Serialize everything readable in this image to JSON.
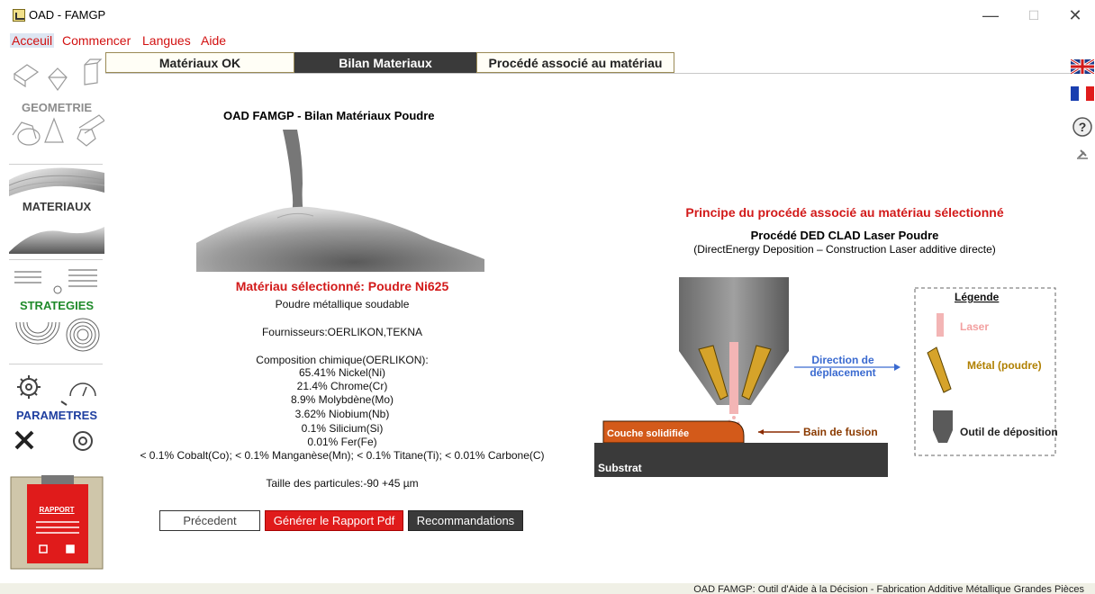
{
  "window": {
    "title": "OAD - FAMGP",
    "minimize": "—",
    "maximize": "☐",
    "close": "✕"
  },
  "menu": [
    "Acceuil",
    "Commencer",
    "Langues",
    "Aide"
  ],
  "sidebar": {
    "geometrie": "GEOMETRIE",
    "materiaux": "MATERIAUX",
    "strategies": "STRATEGIES",
    "parametres": "PARAMETRES",
    "rapport": "RAPPORT",
    "colors": {
      "geometrie": "#8c8c8c",
      "materiaux": "#3a3a3a",
      "strategies": "#1f8a2a",
      "parametres": "#1f3fa0",
      "rapport": "#e01b1b"
    }
  },
  "tabs": [
    "Matériaux OK",
    "Bilan Materiaux",
    "Procédé associé au matériau"
  ],
  "content": {
    "title": "OAD FAMGP - Bilan Matériaux Poudre",
    "material_title": "Matériau sélectionné: Poudre Ni625",
    "description": "Poudre métallique soudable",
    "suppliers": "Fournisseurs:OERLIKON,TEKNA",
    "composition_title": "Composition chimique(OERLIKON):",
    "composition": [
      "65.41% Nickel(Ni)",
      "21.4% Chrome(Cr)",
      "8.9% Molybdène(Mo)",
      "3.62% Niobium(Nb)",
      "0.1% Silicium(Si)",
      "0.01% Fer(Fe)",
      "< 0.1% Cobalt(Co); < 0.1% Manganèse(Mn); < 0.1% Titane(Ti); < 0.01% Carbone(C)"
    ],
    "particle_size": "Taille des particules:-90 +45 µm"
  },
  "buttons": {
    "previous": "Précedent",
    "generate_pdf": "Générer le Rapport Pdf",
    "recommendations": "Recommandations"
  },
  "process": {
    "heading": "Principe du procédé associé au matériau sélectionné",
    "name": "Procédé DED CLAD Laser Poudre",
    "subtitle": "(DirectEnergy Deposition – Construction Laser additive directe)",
    "direction_line1": "Direction de",
    "direction_line2": "déplacement",
    "melt_pool": "Bain de fusion",
    "solid_layer": "Couche solidifiée",
    "substrate": "Substrat",
    "legend_title": "Légende",
    "legend_laser": "Laser",
    "legend_metal": "Métal (poudre)",
    "legend_tool": "Outil de déposition"
  },
  "status": "OAD FAMGP: Outil d'Aide à la Décision - Fabrication Additive Métallique Grandes Pièces"
}
